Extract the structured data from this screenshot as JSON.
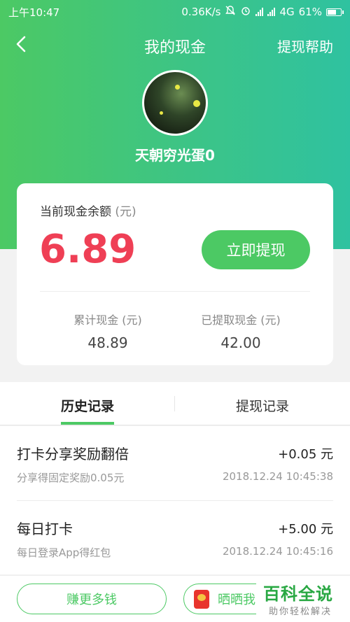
{
  "status_bar": {
    "time": "上午10:47",
    "network_speed": "0.36K/s",
    "network_type": "4G",
    "battery": "61%"
  },
  "nav": {
    "title": "我的现金",
    "help_label": "提现帮助"
  },
  "profile": {
    "username": "天朝穷光蛋0"
  },
  "balance_card": {
    "label": "当前现金余额",
    "unit": "(元)",
    "amount": "6.89",
    "withdraw_button": "立即提现",
    "total_label": "累计现金 (元)",
    "total_value": "48.89",
    "withdrawn_label": "已提取现金 (元)",
    "withdrawn_value": "42.00"
  },
  "tabs": [
    {
      "label": "历史记录",
      "active": true
    },
    {
      "label": "提现记录",
      "active": false
    }
  ],
  "records": [
    {
      "title": "打卡分享奖励翻倍",
      "amount": "+0.05 元",
      "desc": "分享得固定奖励0.05元",
      "time": "2018.12.24 10:45:38"
    },
    {
      "title": "每日打卡",
      "amount": "+5.00 元",
      "desc": "每日登录App得红包",
      "time": "2018.12.24 10:45:16"
    }
  ],
  "bottom": {
    "earn_button": "赚更多钱",
    "share_button": "晒晒我"
  },
  "watermark": {
    "title": "百科全说",
    "subtitle": "助你轻松解决"
  },
  "colors": {
    "accent": "#4cc964",
    "balance": "#ef3f55"
  }
}
